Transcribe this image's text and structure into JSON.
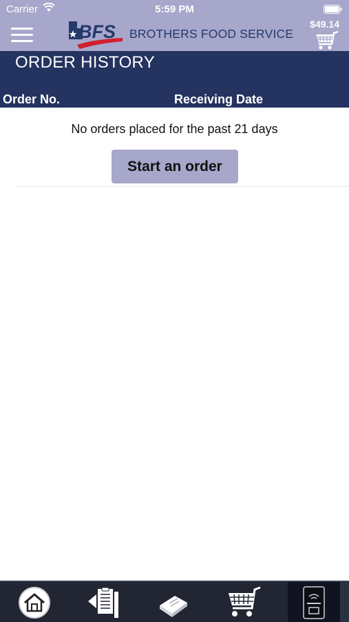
{
  "status_bar": {
    "carrier": "Carrier",
    "time": "5:59 PM"
  },
  "header": {
    "logo_text": "BFS",
    "brand_name": "BROTHERS FOOD SERVICE",
    "cart_total": "$49.14"
  },
  "page": {
    "title": "ORDER HISTORY",
    "columns": {
      "order_no": "Order No.",
      "receiving_date": "Receiving Date"
    },
    "empty_message": "No orders placed for the past 21 days",
    "start_button": "Start an order"
  },
  "tabbar": {
    "tabs": [
      {
        "icon": "home-icon"
      },
      {
        "icon": "order-list-icon"
      },
      {
        "icon": "catalog-book-icon"
      },
      {
        "icon": "cart-icon"
      },
      {
        "icon": "device-icon",
        "active": true
      }
    ]
  },
  "colors": {
    "header_bg": "#a7a7cb",
    "title_bar_bg": "#24335f",
    "brand_blue": "#25396b",
    "accent_red": "#d11f2d",
    "tabbar_bg": "#222633"
  }
}
